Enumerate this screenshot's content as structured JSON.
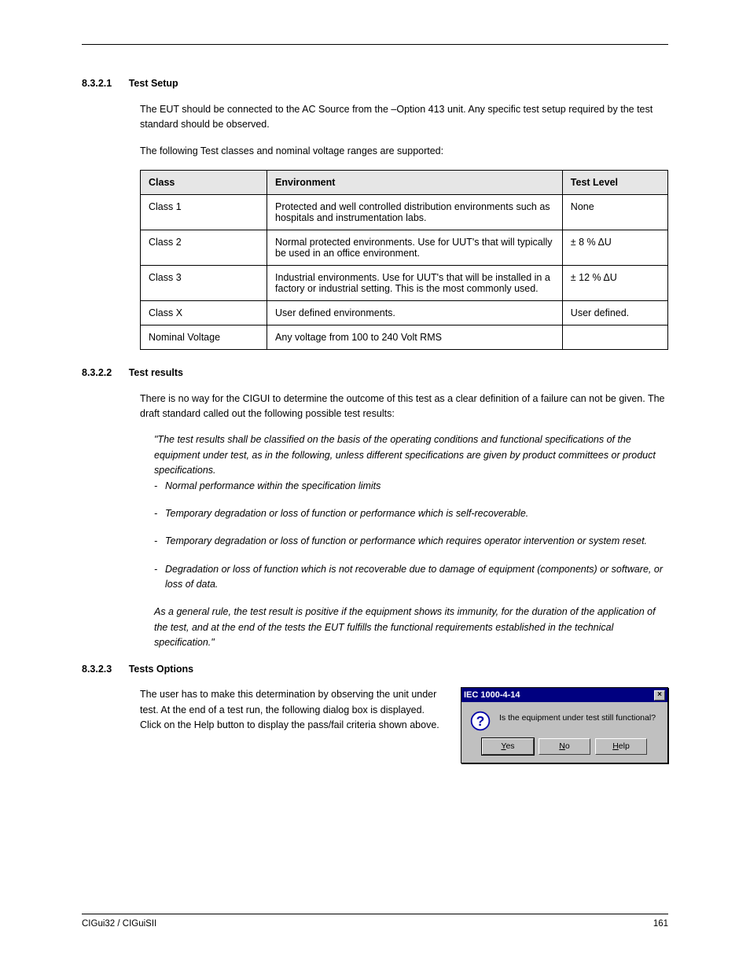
{
  "sections": {
    "setup": {
      "num": "8.3.2.1",
      "title": "Test Setup",
      "paras": [
        "The EUT should be connected to the AC Source from the –Option 413 unit.  Any specific test setup required by the test standard should be observed.",
        "The following Test classes and nominal voltage ranges are supported:"
      ]
    },
    "results": {
      "num": "8.3.2.2",
      "title": "Test results",
      "para": "There is no way for the CIGUI to determine the outcome of this test as a clear definition of a failure can not be given.  The draft standard called out the following possible test results:"
    },
    "options": {
      "para_before": "The user has to make this determination by observing the unit under test.  At the end of a test run, the following dialog box is displayed.  Click on the Help button to display the pass/fail criteria shown above."
    }
  },
  "table": {
    "headers": [
      "Class",
      "Environment",
      "Test Level"
    ],
    "rows": [
      {
        "class": "Class 1",
        "env": "Protected and well controlled distribution environments such as hospitals and instrumentation labs.",
        "level": "None"
      },
      {
        "class": "Class 2",
        "env": "Normal protected environments.  Use for UUT's that will typically be used in an office environment.",
        "level": "± 8 % ΔU"
      },
      {
        "class": "Class 3",
        "env": "Industrial environments.  Use for UUT's that will be installed in a factory or industrial setting.  This is the most commonly used.",
        "level": "± 12 % ΔU"
      },
      {
        "class": "Class X",
        "env": "User defined environments.",
        "level": "User defined."
      },
      {
        "class": "Nominal Voltage",
        "env": "Any voltage from 100 to 240 Volt RMS",
        "level": ""
      }
    ]
  },
  "quote": {
    "lead": "\"The test results shall be classified on the basis of the operating conditions and functional specifications of the equipment under test, as in the following, unless different specifications are given by product committees or product specifications.",
    "items": [
      "Normal performance within the specification limits",
      "Temporary degradation or loss of function or performance which is self-recoverable.",
      "Temporary degradation or loss of function or performance which requires operator intervention or system reset.",
      "Degradation or loss of function which is not recoverable due to damage of equipment (components) or software, or loss of data."
    ],
    "tail": "As a general rule, the test result is positive if the equipment shows its immunity, for the duration of the application of the test, and at the end of the tests the EUT fulfills the functional requirements established in the technical specification.\""
  },
  "dialog": {
    "title": "IEC 1000-4-14",
    "text": "Is the equipment under test still functional?",
    "buttons": {
      "yes": "Yes",
      "no": "No",
      "help": "Help"
    }
  },
  "footer": {
    "left": "CIGui32 / CIGuiSII",
    "right": "161"
  },
  "options_num": "8.3.2.3",
  "options_title": "Tests Options"
}
